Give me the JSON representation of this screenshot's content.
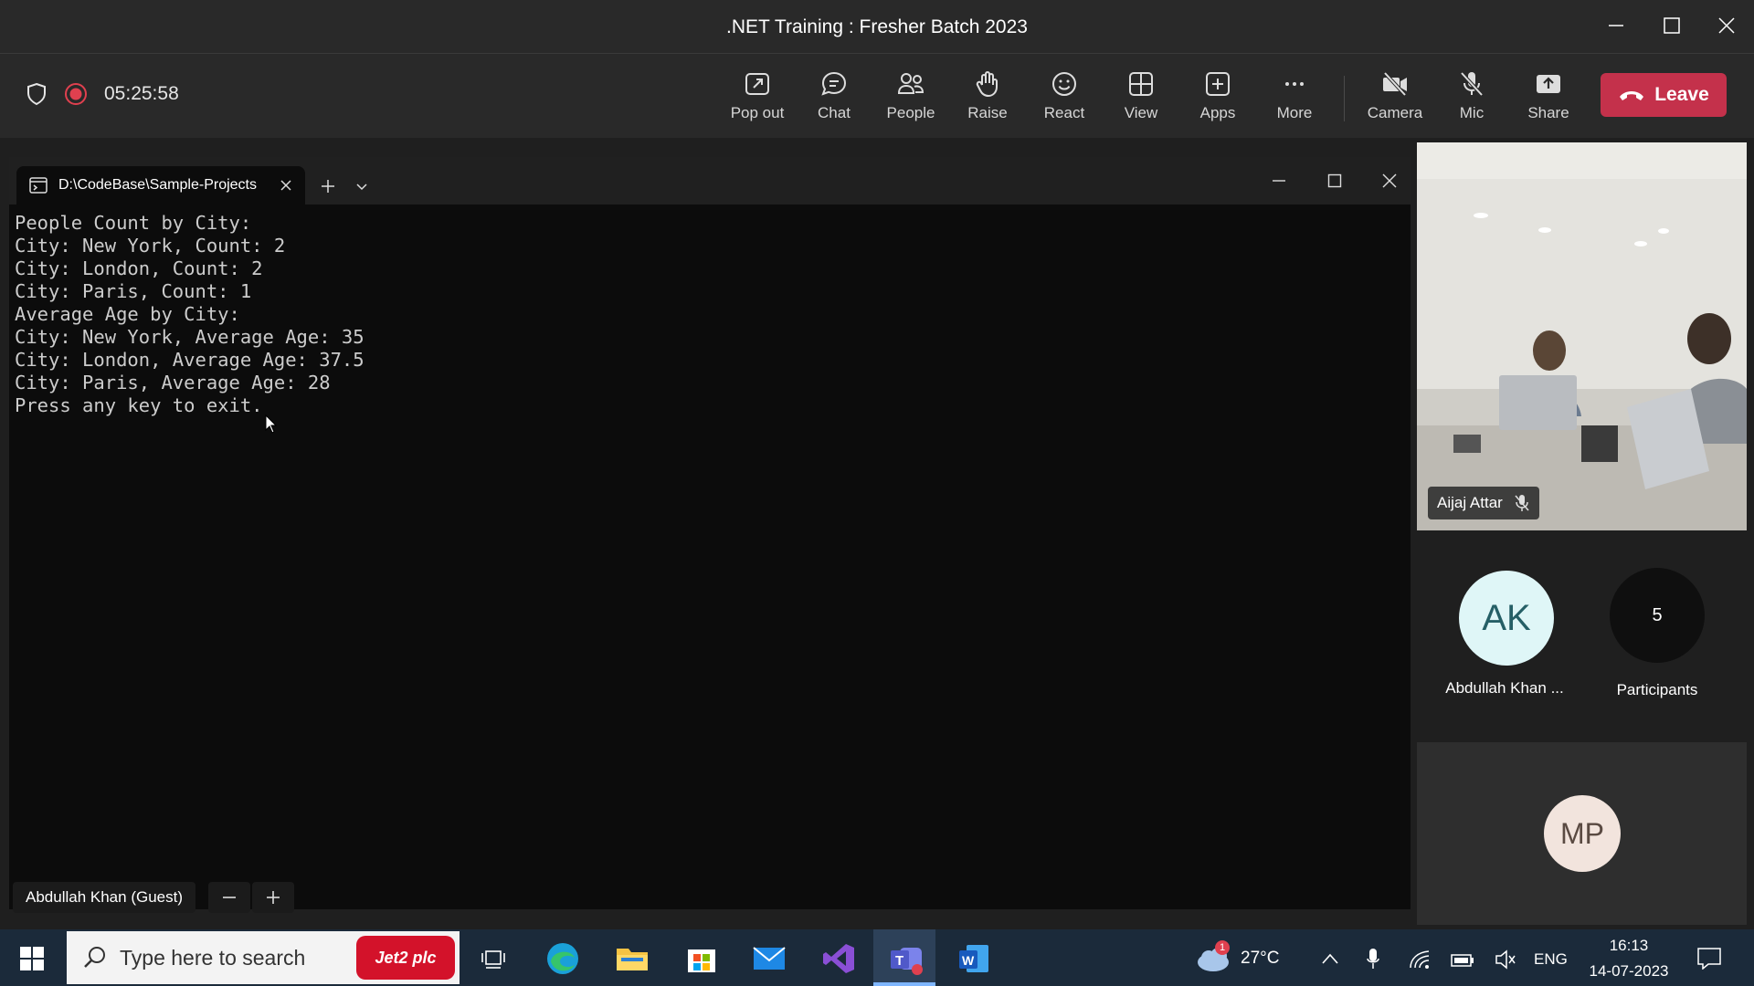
{
  "window": {
    "title": ".NET Training : Fresher Batch 2023"
  },
  "meeting": {
    "timer": "05:25:58"
  },
  "toolbar": {
    "buttons": [
      {
        "label": "Pop out",
        "icon": "pop-out-icon"
      },
      {
        "label": "Chat",
        "icon": "chat-icon"
      },
      {
        "label": "People",
        "icon": "people-icon"
      },
      {
        "label": "Raise",
        "icon": "raise-hand-icon"
      },
      {
        "label": "React",
        "icon": "react-icon"
      },
      {
        "label": "View",
        "icon": "view-icon"
      },
      {
        "label": "Apps",
        "icon": "apps-icon"
      },
      {
        "label": "More",
        "icon": "more-icon"
      },
      {
        "label": "Camera",
        "icon": "camera-off-icon"
      },
      {
        "label": "Mic",
        "icon": "mic-off-icon"
      },
      {
        "label": "Share",
        "icon": "share-icon"
      }
    ],
    "leave_label": "Leave"
  },
  "terminal": {
    "tab_title": "D:\\CodeBase\\Sample-Projects",
    "lines": [
      "People Count by City:",
      "City: New York, Count: 2",
      "City: London, Count: 2",
      "City: Paris, Count: 1",
      "Average Age by City:",
      "City: New York, Average Age: 35",
      "City: London, Average Age: 37.5",
      "City: Paris, Average Age: 28",
      "Press any key to exit."
    ]
  },
  "shared_screen": {
    "presenter": "Abdullah Khan (Guest)"
  },
  "participants": {
    "video": {
      "name": "Aijaj Attar"
    },
    "ak": {
      "initials": "AK",
      "name": "Abdullah Khan ..."
    },
    "count": {
      "value": "5",
      "label": "Participants"
    },
    "mp": {
      "initials": "MP"
    }
  },
  "taskbar": {
    "search_placeholder": "Type here to search",
    "search_badge": "Jet2 plc",
    "weather": {
      "temp": "27°C",
      "badge": "1"
    },
    "language": "ENG",
    "time": "16:13",
    "date": "14-07-2023"
  },
  "colors": {
    "leave": "#c4314b",
    "taskbar": "#1b2a3a",
    "terminal_bg": "#0c0c0c",
    "record": "#e0404f"
  }
}
